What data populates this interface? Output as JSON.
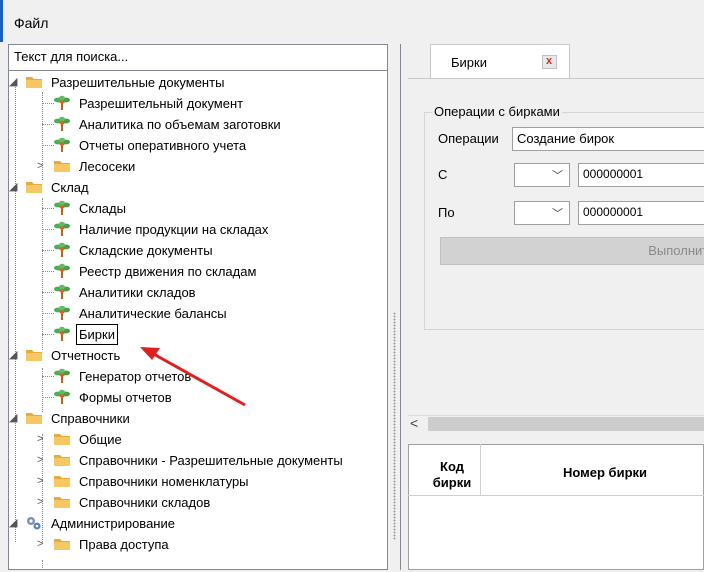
{
  "menu": {
    "file": "Файл"
  },
  "search": {
    "placeholder": "Текст для поиска..."
  },
  "tree": {
    "n0": "Разрешительные документы",
    "n1": "Разрешительный документ",
    "n2": "Аналитика по объемам заготовки",
    "n3": "Отчеты оперативного учета",
    "n4": "Лесосеки",
    "n5": "Склад",
    "n6": "Склады",
    "n7": "Наличие продукции на складах",
    "n8": "Складские документы",
    "n9": "Реестр движения по складам",
    "n10": "Аналитики складов",
    "n11": "Аналитические балансы",
    "n12": "Бирки",
    "n13": "Отчетность",
    "n14": "Генератор отчетов",
    "n15": "Формы отчетов",
    "n16": "Справочники",
    "n17": "Общие",
    "n18": "Справочники - Разрешительные документы",
    "n19": "Справочники номенклатуры",
    "n20": "Справочники складов",
    "n21": "Администрирование",
    "n22": "Права доступа"
  },
  "tab": {
    "label": "Бирки",
    "close": "x"
  },
  "ops": {
    "group_title": "Операции с бирками",
    "operation_label": "Операции",
    "operation_value": "Создание бирок",
    "from_label": "С",
    "from_value": "000000001",
    "to_label": "По",
    "to_value": "000000001",
    "run_button": "Выполнить"
  },
  "grid": {
    "col_code": "Код бирки",
    "col_number": "Номер бирки"
  },
  "icons": {
    "folder": "folder-icon",
    "tree_node": "tree-node-icon",
    "gears": "gears-icon",
    "expander": "expand-arrow-icon",
    "scroll_left": "scroll-left-icon",
    "dropdown": "chevron-down-icon"
  },
  "colors": {
    "arrow": "#e02020",
    "folder": "#f2c14e",
    "leaf_green": "#4caf50",
    "leaf_trunk": "#b5651d"
  }
}
